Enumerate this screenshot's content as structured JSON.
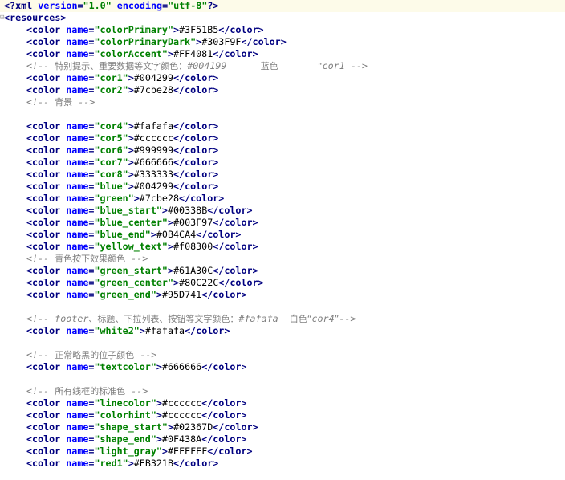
{
  "prolog": {
    "open": "<?xml ",
    "version_attr": "version",
    "version_val": "\"1.0\"",
    "encoding_attr": "encoding",
    "encoding_val": "\"utf-8\"",
    "close": "?>"
  },
  "root_open": "<resources>",
  "tag_open": "<color ",
  "name_attr": "name",
  "tag_close": "</color>",
  "lines": [
    {
      "type": "color",
      "name": "\"colorPrimary\"",
      "value": "#3F51B5"
    },
    {
      "type": "color",
      "name": "\"colorPrimaryDark\"",
      "value": "#303F9F"
    },
    {
      "type": "color",
      "name": "\"colorAccent\"",
      "value": "#FF4081"
    },
    {
      "type": "comment",
      "text": "<!-- 特别提示、重要数据等文字颜色：#004199      蓝色       “cor1 -->"
    },
    {
      "type": "color",
      "name": "\"cor1\"",
      "value": "#004299"
    },
    {
      "type": "color",
      "name": "\"cor2\"",
      "value": "#7cbe28"
    },
    {
      "type": "comment",
      "text": "<!-- 背景 -->"
    },
    {
      "type": "blank"
    },
    {
      "type": "color",
      "name": "\"cor4\"",
      "value": "#fafafa"
    },
    {
      "type": "color",
      "name": "\"cor5\"",
      "value": "#cccccc"
    },
    {
      "type": "color",
      "name": "\"cor6\"",
      "value": "#999999"
    },
    {
      "type": "color",
      "name": "\"cor7\"",
      "value": "#666666"
    },
    {
      "type": "color",
      "name": "\"cor8\"",
      "value": "#333333"
    },
    {
      "type": "color",
      "name": "\"blue\"",
      "value": "#004299"
    },
    {
      "type": "color",
      "name": "\"green\"",
      "value": "#7cbe28"
    },
    {
      "type": "color",
      "name": "\"blue_start\"",
      "value": "#00338B"
    },
    {
      "type": "color",
      "name": "\"blue_center\"",
      "value": "#003F97"
    },
    {
      "type": "color",
      "name": "\"blue_end\"",
      "value": "#0B4CA4"
    },
    {
      "type": "color",
      "name": "\"yellow_text\"",
      "value": "#f08300"
    },
    {
      "type": "comment",
      "text": "<!-- 青色按下效果颜色 -->"
    },
    {
      "type": "color",
      "name": "\"green_start\"",
      "value": "#61A30C"
    },
    {
      "type": "color",
      "name": "\"green_center\"",
      "value": "#80C22C"
    },
    {
      "type": "color",
      "name": "\"green_end\"",
      "value": "#95D741"
    },
    {
      "type": "blank"
    },
    {
      "type": "comment",
      "text": "<!-- footer、标题、下拉列表、按钮等文字颜色：#fafafa  白色“cor4”-->"
    },
    {
      "type": "color",
      "name": "\"white2\"",
      "value": "#fafafa"
    },
    {
      "type": "blank"
    },
    {
      "type": "comment",
      "text": "<!-- 正常略黑的位子颜色 -->"
    },
    {
      "type": "color",
      "name": "\"textcolor\"",
      "value": "#666666"
    },
    {
      "type": "blank"
    },
    {
      "type": "comment",
      "text": "<!-- 所有线框的标准色 -->"
    },
    {
      "type": "color",
      "name": "\"linecolor\"",
      "value": "#cccccc"
    },
    {
      "type": "color",
      "name": "\"colorhint\"",
      "value": "#cccccc"
    },
    {
      "type": "color",
      "name": "\"shape_start\"",
      "value": "#02367D"
    },
    {
      "type": "color",
      "name": "\"shape_end\"",
      "value": "#0F438A"
    },
    {
      "type": "color",
      "name": "\"light_gray\"",
      "value": "#EFEFEF"
    },
    {
      "type": "color",
      "name": "\"red1\"",
      "value": "#EB321B"
    }
  ]
}
